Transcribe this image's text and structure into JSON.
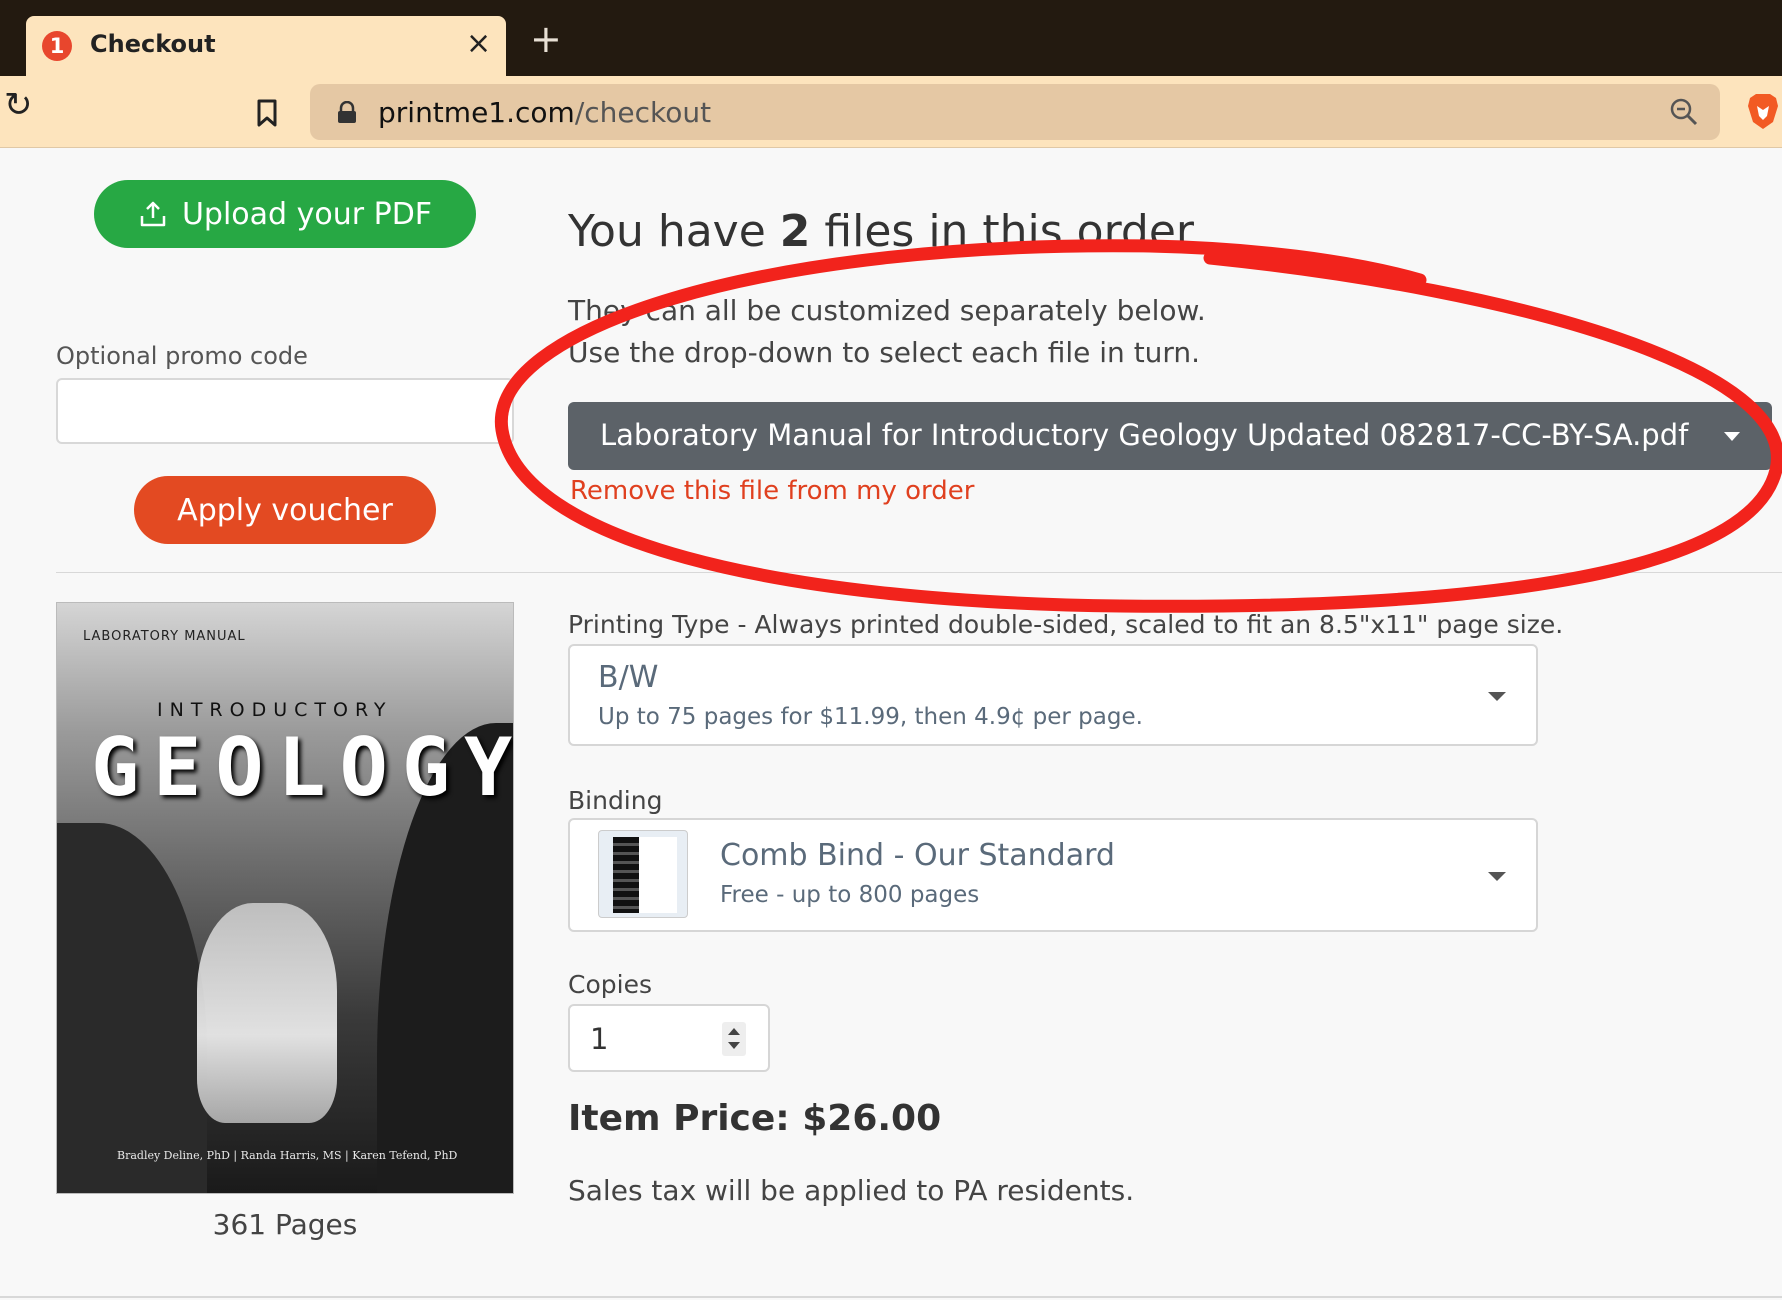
{
  "browser": {
    "tab_badge": "1",
    "tab_title": "Checkout",
    "tab_close": "×",
    "new_tab": "+",
    "reload": "↻",
    "url_host": "printme1.com",
    "url_path": "/checkout"
  },
  "sidebar": {
    "upload_button": "Upload your PDF",
    "promo_label": "Optional promo code",
    "promo_value": "",
    "apply_button": "Apply voucher"
  },
  "order": {
    "heading_prefix": "You have ",
    "file_count": "2",
    "heading_suffix": " files in this order",
    "line1": "They can all be customized separately below.",
    "line2": "Use the drop-down to select each file in turn.",
    "selected_file": "Laboratory Manual for Introductory Geology Updated 082817-CC-BY-SA.pdf",
    "remove_link": "Remove this file from my order"
  },
  "cover": {
    "small_title": "LABORATORY MANUAL",
    "intro": "INTRODUCTORY",
    "main_title": "GEOLOGY",
    "authors": "Bradley Deline, PhD  |  Randa Harris, MS  |  Karen Tefend, PhD",
    "pages_caption": "361 Pages"
  },
  "printing": {
    "label": "Printing Type - Always printed double-sided, scaled to fit an 8.5\"x11\" page size.",
    "value": "B/W",
    "sub": "Up to 75 pages for $11.99, then 4.9¢ per page."
  },
  "binding": {
    "label": "Binding",
    "value": "Comb Bind - Our Standard",
    "sub": "Free - up to 800 pages"
  },
  "copies": {
    "label": "Copies",
    "value": "1"
  },
  "price": {
    "item_price": "Item Price: $26.00",
    "tax_note": "Sales tax will be applied to PA residents."
  },
  "colors": {
    "upload_green": "#27a844",
    "apply_red": "#e34a22",
    "select_gray": "#5c6268",
    "remove_red": "#e0401f",
    "annotation_red": "#f2231c"
  },
  "icons": {
    "tab_favicon": "numbered-badge-icon",
    "bookmark": "bookmark-icon",
    "lock": "lock-icon",
    "zoom": "zoom-out-icon",
    "brave": "brave-lion-icon",
    "upload": "upload-icon"
  }
}
